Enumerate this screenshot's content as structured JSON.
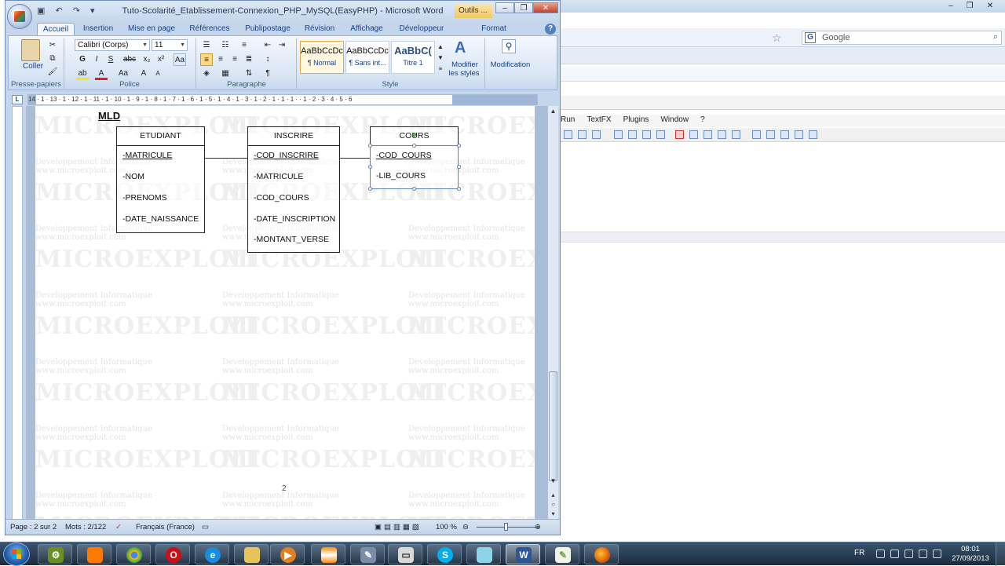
{
  "background_app": {
    "search_placeholder": "Google",
    "menu": [
      "Run",
      "TextFX",
      "Plugins",
      "Window",
      "?"
    ]
  },
  "word": {
    "title": "Tuto-Scolarité_Etablissement-Connexion_PHP_MySQL(EasyPHP) - Microsoft Word",
    "tools_label": "Outils ...",
    "tabs": [
      "Accueil",
      "Insertion",
      "Mise en page",
      "Références",
      "Publipostage",
      "Révision",
      "Affichage",
      "Développeur",
      "Format"
    ],
    "ribbon": {
      "clipboard": {
        "paste_label": "Coller",
        "group_label": "Presse-papiers"
      },
      "font": {
        "name": "Calibri (Corps)",
        "size": "11",
        "group_label": "Police"
      },
      "paragraph": {
        "group_label": "Paragraphe"
      },
      "styles": {
        "group_label": "Style",
        "tiles": [
          {
            "preview": "AaBbCcDc",
            "name": "¶ Normal"
          },
          {
            "preview": "AaBbCcDc",
            "name": "¶ Sans int..."
          },
          {
            "preview": "AaBbC(",
            "name": "Titre 1"
          }
        ],
        "modify_label_1": "Modifier",
        "modify_label_2": "les styles"
      },
      "editing": {
        "label": "Modification"
      }
    },
    "ruler_numbers": "14 · 1 · 13 · 1 · 12 · 1 · 11 · 1 · 10 · 1 · 9 · 1 · 8 · 1 · 7 · 1 · 6 · 1 · 5 · 1 · 4 · 1 · 3 · 1 · 2 · 1 · 1 · 1 · · 1 · 2 · 3 · 4 · 5 · 6",
    "document": {
      "heading": "MLD",
      "entities": [
        {
          "name": "ETUDIANT",
          "attributes": [
            "-MATRICULE",
            "-NOM",
            "-PRENOMS",
            "-DATE_NAISSANCE"
          ],
          "primary_key": "MATRICULE"
        },
        {
          "name": "INSCRIRE",
          "attributes": [
            "-COD_INSCRIRE",
            "-MATRICULE",
            "-COD_COURS",
            "-DATE_INSCRIPTION",
            "-MONTANT_VERSE"
          ],
          "primary_key": "COD_INSCRIRE"
        },
        {
          "name": "COURS",
          "attributes": [
            "-COD_COURS",
            "-LIB_COURS"
          ],
          "primary_key": "COD_COURS"
        }
      ],
      "watermark_big": "MICROEXPLOIT",
      "watermark_line1": "Developpement Informatique",
      "watermark_line2": "www.microexploit.com",
      "page_number": "2"
    },
    "status": {
      "page": "Page : 2 sur 2",
      "words": "Mots : 2/122",
      "language": "Français (France)",
      "zoom": "100 %"
    }
  },
  "taskbar": {
    "apps": [
      "explorer-tool",
      "orange",
      "chrome",
      "opera",
      "internet-explorer",
      "folder",
      "media-player",
      "vlc",
      "network-tool",
      "window-app",
      "skype",
      "notepad",
      "word",
      "notepad-plus",
      "firefox"
    ],
    "tray": {
      "language": "FR",
      "time": "08:01",
      "date": "27/09/2013"
    }
  }
}
